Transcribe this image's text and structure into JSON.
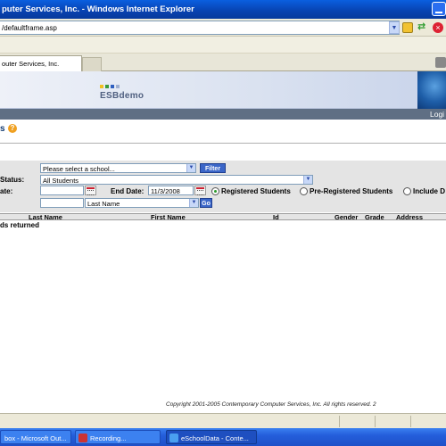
{
  "window": {
    "title": "puter Services, Inc. - Windows Internet Explorer"
  },
  "browser": {
    "address": "/defaultframe.asp",
    "tab_label": "outer Services, Inc."
  },
  "header": {
    "brand": "ESBdemo",
    "logout_label": "Logi"
  },
  "page": {
    "heading_fragment": "s",
    "help_glyph": "?"
  },
  "filters": {
    "status_label": "Status:",
    "date_label": "ate:",
    "school_select": "Please select a school...",
    "filter_button": "Filter",
    "status_select": "All Students",
    "start_date": "",
    "end_date_label": "End Date:",
    "end_date": "11/3/2008",
    "radio_registered": "Registered Students",
    "radio_preregistered": "Pre-Registered Students",
    "radio_include": "Include D",
    "search_text": "",
    "sort_select": "Last Name",
    "go_button": "Go"
  },
  "table": {
    "headers": [
      "Last Name",
      "First Name",
      "Id",
      "Gender",
      "Grade",
      "Address"
    ],
    "records_text": "ds returned"
  },
  "footer": {
    "copyright": "Copyright 2001-2005 Contemporary Computer Services, Inc. All rights reserved. 2"
  },
  "taskbar": {
    "items": [
      {
        "label": "box - Microsoft Out..."
      },
      {
        "label": "Recording..."
      },
      {
        "label": "eSchoolData - Conte..."
      }
    ]
  },
  "colors": {
    "title_bar": "#0842b0",
    "filter_button": "#3b66c8",
    "login_strip": "#5f6f84",
    "taskbar": "#245edb"
  }
}
